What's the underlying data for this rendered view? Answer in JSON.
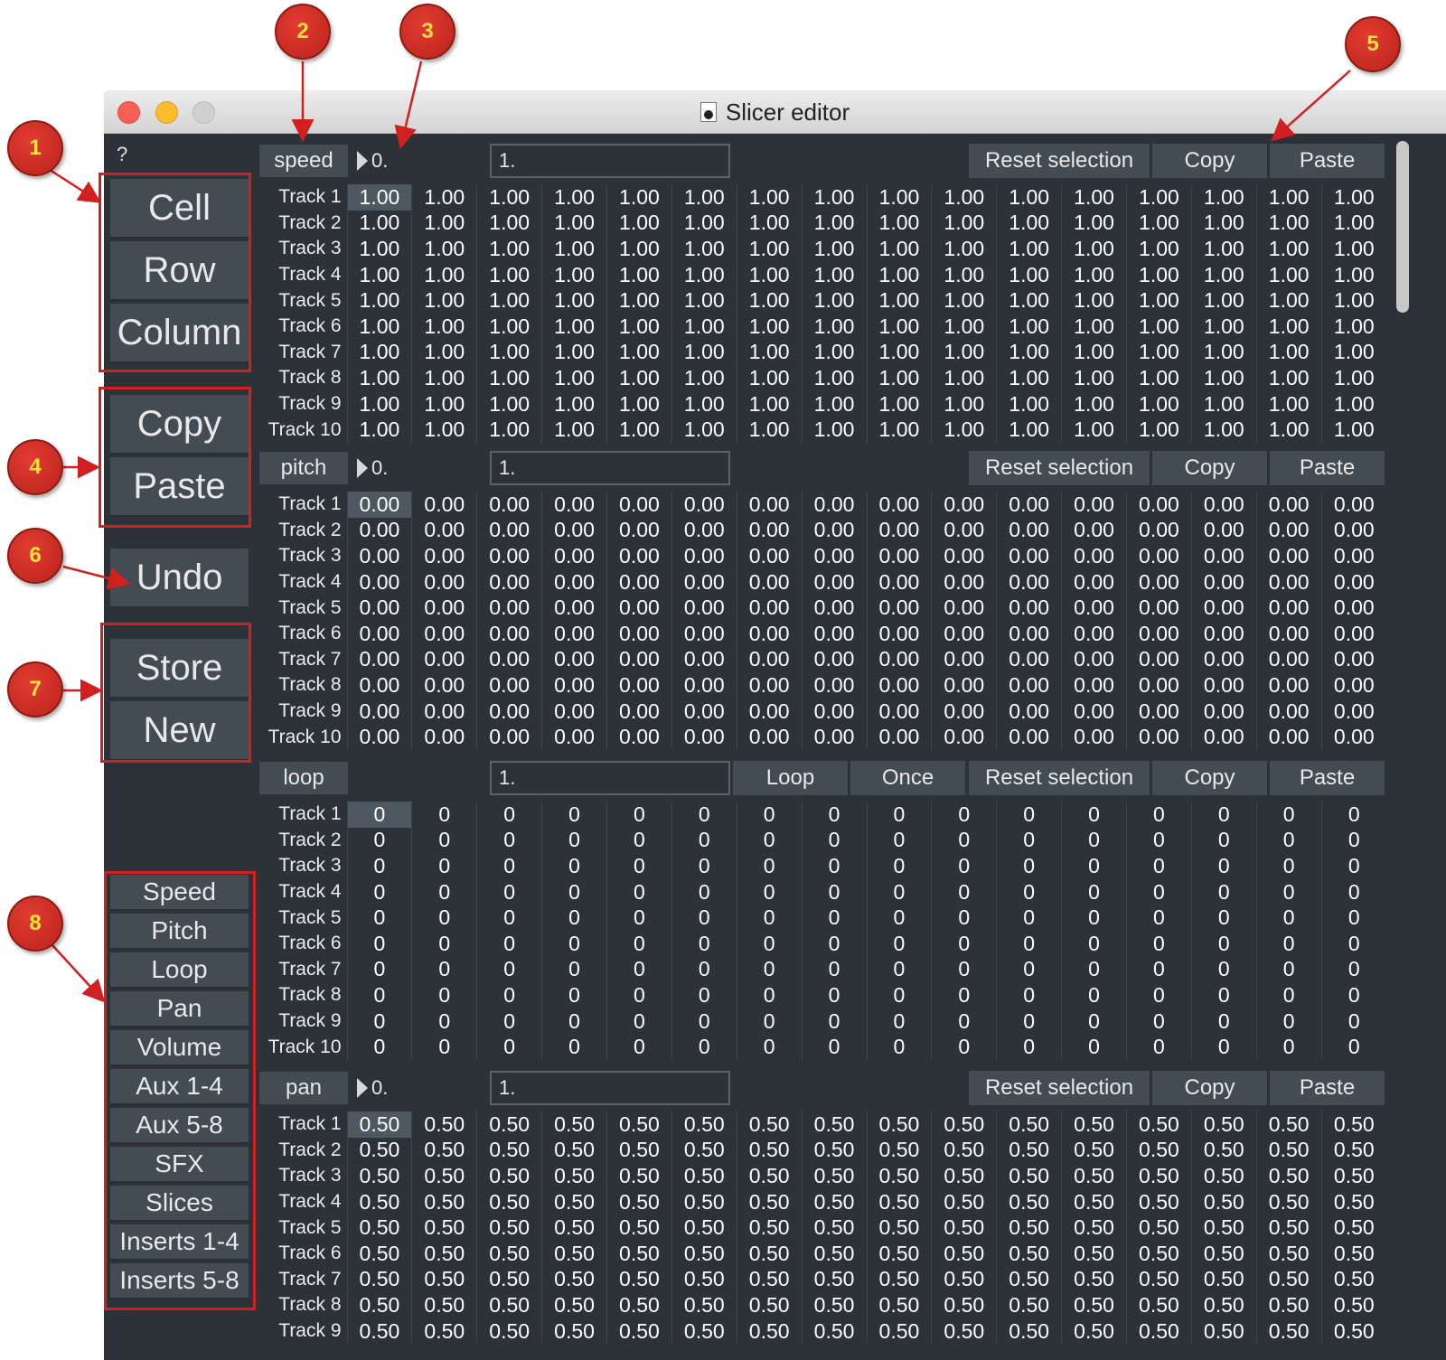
{
  "window": {
    "title": "Slicer editor"
  },
  "left": {
    "help": "?",
    "selection_buttons": [
      "Cell",
      "Row",
      "Column"
    ],
    "clipboard_buttons": [
      "Copy",
      "Paste"
    ],
    "undo": "Undo",
    "preset_buttons": [
      "Store",
      "New"
    ],
    "param_buttons": [
      "Speed",
      "Pitch",
      "Loop",
      "Pan",
      "Volume",
      "Aux 1-4",
      "Aux 5-8",
      "SFX",
      "Slices",
      "Inserts 1-4",
      "Inserts 5-8"
    ]
  },
  "sections": [
    {
      "label": "speed",
      "num": "0.",
      "field": "1.",
      "reset": "Reset selection",
      "copy": "Copy",
      "paste": "Paste",
      "cell": "1.00",
      "rows": [
        "Track 1",
        "Track 2",
        "Track 3",
        "Track 4",
        "Track 5",
        "Track 6",
        "Track 7",
        "Track 8",
        "Track 9",
        "Track 10"
      ]
    },
    {
      "label": "pitch",
      "num": "0.",
      "field": "1.",
      "reset": "Reset selection",
      "copy": "Copy",
      "paste": "Paste",
      "cell": "0.00",
      "rows": [
        "Track 1",
        "Track 2",
        "Track 3",
        "Track 4",
        "Track 5",
        "Track 6",
        "Track 7",
        "Track 8",
        "Track 9",
        "Track 10"
      ]
    },
    {
      "label": "loop",
      "field": "1.",
      "loop": "Loop",
      "once": "Once",
      "reset": "Reset selection",
      "copy": "Copy",
      "paste": "Paste",
      "cell": "0",
      "rows": [
        "Track 1",
        "Track 2",
        "Track 3",
        "Track 4",
        "Track 5",
        "Track 6",
        "Track 7",
        "Track 8",
        "Track 9",
        "Track 10"
      ]
    },
    {
      "label": "pan",
      "num": "0.",
      "field": "1.",
      "reset": "Reset selection",
      "copy": "Copy",
      "paste": "Paste",
      "cell": "0.50",
      "rows": [
        "Track 1",
        "Track 2",
        "Track 3",
        "Track 4",
        "Track 5",
        "Track 6",
        "Track 7",
        "Track 8",
        "Track 9"
      ]
    }
  ],
  "annotations": [
    "1",
    "2",
    "3",
    "4",
    "5",
    "6",
    "7",
    "8"
  ],
  "colors": {
    "background": "#2d3238",
    "button": "#434b53",
    "highlight": "#d21f1f",
    "badge": "#c9291f",
    "badge_text": "#ffe23a"
  }
}
